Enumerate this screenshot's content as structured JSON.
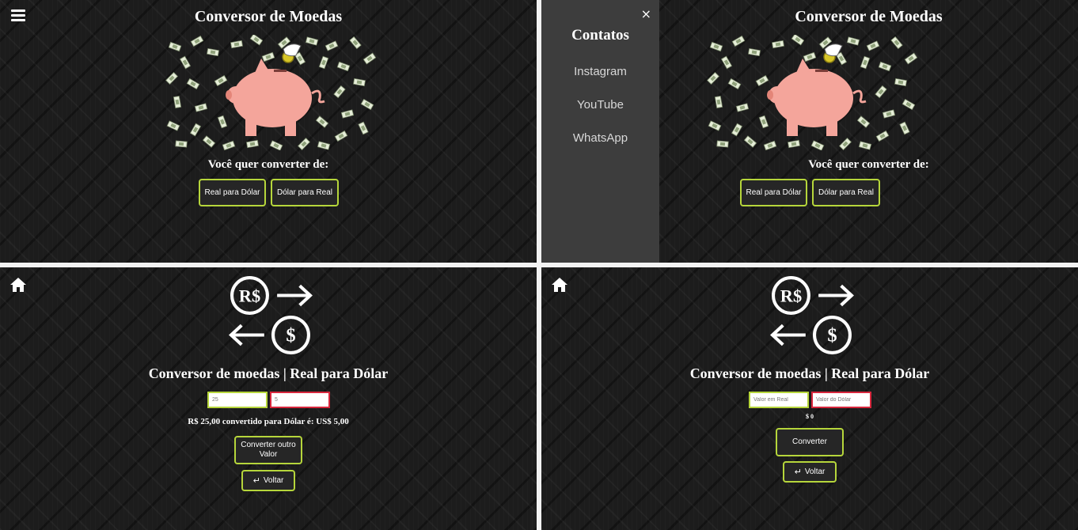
{
  "panel1": {
    "title": "Conversor de Moedas",
    "prompt": "Você quer converter de:",
    "btn_real_dolar": "Real para Dólar",
    "btn_dolar_real": "Dólar para Real"
  },
  "panel2": {
    "title": "Conversor de Moedas",
    "prompt": "Você quer converter de:",
    "btn_real_dolar": "Real para Dólar",
    "btn_dolar_real": "Dólar para Real",
    "sidebar": {
      "close": "×",
      "heading": "Contatos",
      "links": [
        "Instagram",
        "YouTube",
        "WhatsApp"
      ]
    }
  },
  "panel3": {
    "title": "Conversor de moedas | Real para Dólar",
    "input_real_value": "25",
    "input_dollar_value": "5",
    "result": "R$ 25,00 convertido para Dólar é: US$ 5,00",
    "btn_converter_outro": "Converter outro Valor",
    "btn_voltar": "Voltar"
  },
  "panel4": {
    "title": "Conversor de moedas | Real para Dólar",
    "input_real_placeholder": "Valor em Real",
    "input_dollar_placeholder": "Valor do Dólar",
    "result": "$ 0",
    "btn_converter": "Converter",
    "btn_voltar": "Voltar"
  },
  "icons": {
    "menu": "hamburger-icon",
    "close": "close-icon",
    "home": "home-icon",
    "back": "return-arrow-icon",
    "exchange": "currency-exchange-icon",
    "hero": "piggy-bank-money-illustration"
  },
  "colors": {
    "accent_border": "#b6d63b",
    "error_border": "#d8273d",
    "sidebar_bg": "#3d3d3d",
    "pig": "#f4a59b"
  },
  "symbols": {
    "real": "R$",
    "dollar": "$"
  }
}
